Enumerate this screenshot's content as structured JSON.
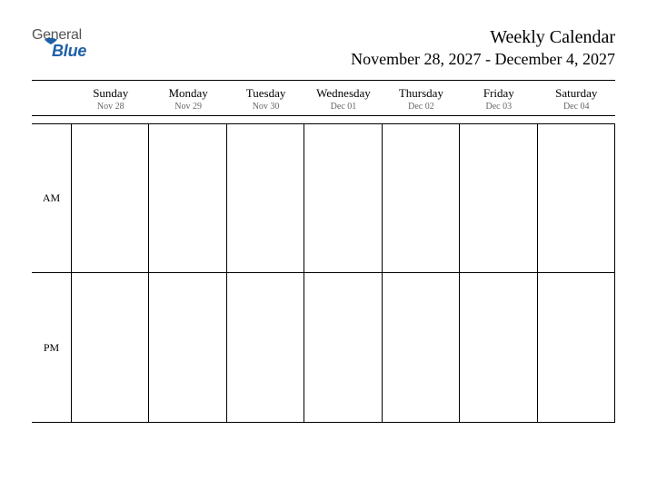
{
  "logo": {
    "text_general": "General",
    "text_blue": "Blue"
  },
  "header": {
    "title": "Weekly Calendar",
    "date_range": "November 28, 2027 - December 4, 2027"
  },
  "days": [
    {
      "name": "Sunday",
      "date": "Nov 28"
    },
    {
      "name": "Monday",
      "date": "Nov 29"
    },
    {
      "name": "Tuesday",
      "date": "Nov 30"
    },
    {
      "name": "Wednesday",
      "date": "Dec 01"
    },
    {
      "name": "Thursday",
      "date": "Dec 02"
    },
    {
      "name": "Friday",
      "date": "Dec 03"
    },
    {
      "name": "Saturday",
      "date": "Dec 04"
    }
  ],
  "periods": [
    {
      "label": "AM"
    },
    {
      "label": "PM"
    }
  ]
}
